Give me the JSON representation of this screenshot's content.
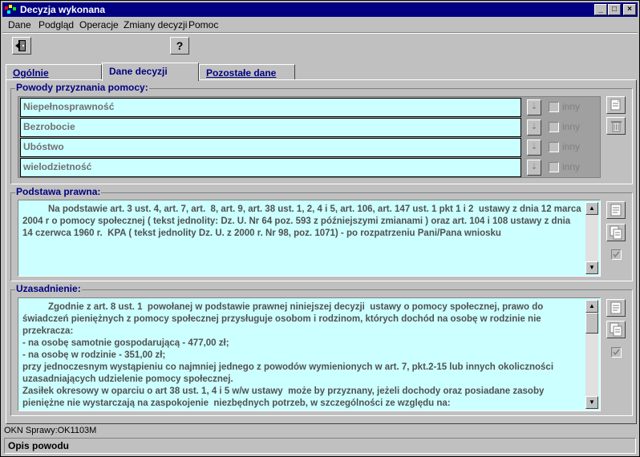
{
  "window": {
    "title": "Decyzja wykonana",
    "controls": {
      "minimize": "_",
      "maximize": "□",
      "close": "×"
    }
  },
  "menu": [
    {
      "label": "Dane"
    },
    {
      "label": "Podgląd"
    },
    {
      "label": "Operacje"
    },
    {
      "label": "Zmiany decyzji"
    },
    {
      "label": "Pomoc"
    }
  ],
  "toolbar": {
    "exit_icon": "exit-door-icon",
    "help_label": "?"
  },
  "tabs": [
    {
      "label": "Ogólnie"
    },
    {
      "label": "Dane decyzji"
    },
    {
      "label": "Pozostałe dane"
    }
  ],
  "reasons": {
    "title": "Powody przyznania pomocy:",
    "items": [
      {
        "label": "Niepełnosprawność",
        "other_label": "inny"
      },
      {
        "label": "Bezrobocie",
        "other_label": "inny"
      },
      {
        "label": "Ubóstwo",
        "other_label": "inny"
      },
      {
        "label": "wielodzietność",
        "other_label": "inny"
      }
    ]
  },
  "legal_basis": {
    "title": "Podstawa prawna:",
    "text": "          Na podstawie art. 3 ust. 4, art. 7, art.  8, art. 9, art. 38 ust. 1, 2, 4 i 5, art. 106, art. 147 ust. 1 pkt 1 i 2  ustawy z dnia 12 marca 2004 r o pomocy społecznej ( tekst jednolity: Dz. U. Nr 64 poz. 593 z późniejszymi zmianami ) oraz art. 104 i 108 ustawy z dnia 14 czerwca 1960 r.  KPA ( tekst jednolity Dz. U. z 2000 r. Nr 98, poz. 1071) - po rozpatrzeniu Pani/Pana wniosku"
  },
  "justification": {
    "title": "Uzasadnienie:",
    "text": "          Zgodnie z art. 8 ust. 1  powołanej w podstawie prawnej niniejszej decyzji  ustawy o pomocy społecznej, prawo do świadczeń pieniężnych z pomocy społecznej przysługuje osobom i rodzinom, których dochód na osobę w rodzinie nie przekracza:\n- na osobę samotnie gospodarującą - 477,00 zł;\n- na osobę w rodzinie - 351,00 zł;\nprzy jednoczesnym wystąpieniu co najmniej jednego z powodów wymienionych w art. 7, pkt.2-15 lub innych okoliczności uzasadniających udzielenie pomocy społecznej.\nZasiłek okresowy w oparciu o art 38 ust. 1, 4 i 5 w/w ustawy  może by przyznany, jeżeli dochody oraz posiadane zasoby pieniężne nie wystarczają na zaspokojenie  niezbędnych potrzeb, w szczególności ze względu na:"
  },
  "status": {
    "case_line": "OKN Sprawy:OK1103M",
    "message": "Opis powodu"
  }
}
